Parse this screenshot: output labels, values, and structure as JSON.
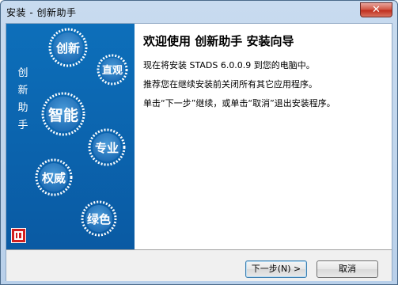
{
  "window": {
    "title": "安装 - 创新助手",
    "close_symbol": "✕"
  },
  "sidebar": {
    "vertical_label": [
      "创",
      "新",
      "助",
      "手"
    ],
    "badges": [
      "创新",
      "直观",
      "智能",
      "专业",
      "权威",
      "绿色"
    ]
  },
  "content": {
    "heading": "欢迎使用  创新助手  安装向导",
    "line1": "现在将安装 STADS 6.0.0.9 到您的电脑中。",
    "line2": "推荐您在继续安装前关闭所有其它应用程序。",
    "line3": "单击“下一步”继续，或单击“取消”退出安装程序。"
  },
  "buttons": {
    "next": "下一步(N) >",
    "cancel": "取消"
  },
  "colors": {
    "sidebar": "#0b63ad",
    "badge": "#2f7fc4",
    "close": "#c0301f"
  }
}
